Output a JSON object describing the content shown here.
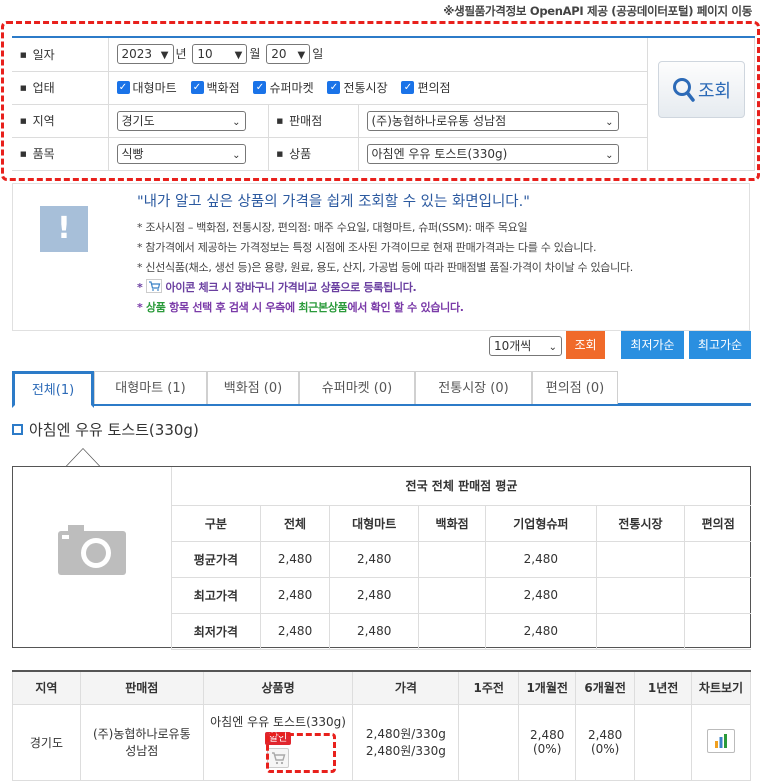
{
  "top_link": "※생필품가격정보 OpenAPI 제공 (공공데이터포털) 페이지 이동",
  "search": {
    "date_label": "일자",
    "year": "2023",
    "year_unit": "년",
    "month": "10",
    "month_unit": "월",
    "day": "20",
    "day_unit": "일",
    "biz_label": "업태",
    "biz_types": [
      "대형마트",
      "백화점",
      "슈퍼마켓",
      "전통시장",
      "편의점"
    ],
    "region_label": "지역",
    "region_value": "경기도",
    "store_label": "판매점",
    "store_value": "(주)농협하나로유통 성남점",
    "category_label": "품목",
    "category_value": "식빵",
    "product_label": "상품",
    "product_value": "아침엔 우유 토스트(330g)",
    "search_button": "조회"
  },
  "notice": {
    "headline": "\"내가 알고 싶은 상품의 가격을 쉽게 조회할 수 있는 화면입니다.\"",
    "lines": [
      "조사시점 – 백화점, 전통시장, 편의점: 매주 수요일, 대형마트, 슈퍼(SSM): 매주 목요일",
      "참가격에서 제공하는 가격정보는 특정 시점에 조사된 가격이므로 현재 판매가격과는 다를 수 있습니다.",
      "신선식품(채소, 생선 등)은 용량, 원료, 용도, 산지, 가공법 등에 따라 판매점별 품질·가격이 차이날 수 있습니다."
    ],
    "cart_line": "아이콘 체크 시 장바구니 가격비교 상품으로 등록됩니다.",
    "recent_line_1": "상품",
    "recent_line_2": " 항목 선택 후 검색 시 우측에 ",
    "recent_line_3": "최근본상품",
    "recent_line_4": "에서 확인 할 수 있습니다."
  },
  "list_controls": {
    "per_page": "10개씩",
    "search": "조회",
    "lowest": "최저가순",
    "highest": "최고가순"
  },
  "tabs": [
    {
      "label": "전체(1)"
    },
    {
      "label": "대형마트 (1)"
    },
    {
      "label": "백화점 (0)"
    },
    {
      "label": "슈퍼마켓 (0)"
    },
    {
      "label": "전통시장 (0)"
    },
    {
      "label": "편의점 (0)"
    }
  ],
  "product_title": "아침엔 우유 토스트(330g)",
  "avg_table": {
    "caption": "전국 전체 판매점 평균",
    "headers": [
      "구분",
      "전체",
      "대형마트",
      "백화점",
      "기업형슈퍼",
      "전통시장",
      "편의점"
    ],
    "rows": [
      {
        "label": "평균가격",
        "cells": [
          "2,480",
          "2,480",
          "",
          "2,480",
          "",
          ""
        ]
      },
      {
        "label": "최고가격",
        "cells": [
          "2,480",
          "2,480",
          "",
          "2,480",
          "",
          ""
        ]
      },
      {
        "label": "최저가격",
        "cells": [
          "2,480",
          "2,480",
          "",
          "2,480",
          "",
          ""
        ]
      }
    ]
  },
  "result_table": {
    "headers": [
      "지역",
      "판매점",
      "상품명",
      "가격",
      "1주전",
      "1개월전",
      "6개월전",
      "1년전",
      "차트보기"
    ],
    "row": {
      "region": "경기도",
      "store": "(주)농협하나로유통 성남점",
      "product": "아침엔 우유 토스트(330g)",
      "badge": "할인",
      "price_1": "2,480원/330g",
      "price_2": "2,480원/330g",
      "week": "",
      "month": "2,480",
      "month_pct": "(0%)",
      "half": "2,480",
      "half_pct": "(0%)",
      "year": ""
    }
  }
}
